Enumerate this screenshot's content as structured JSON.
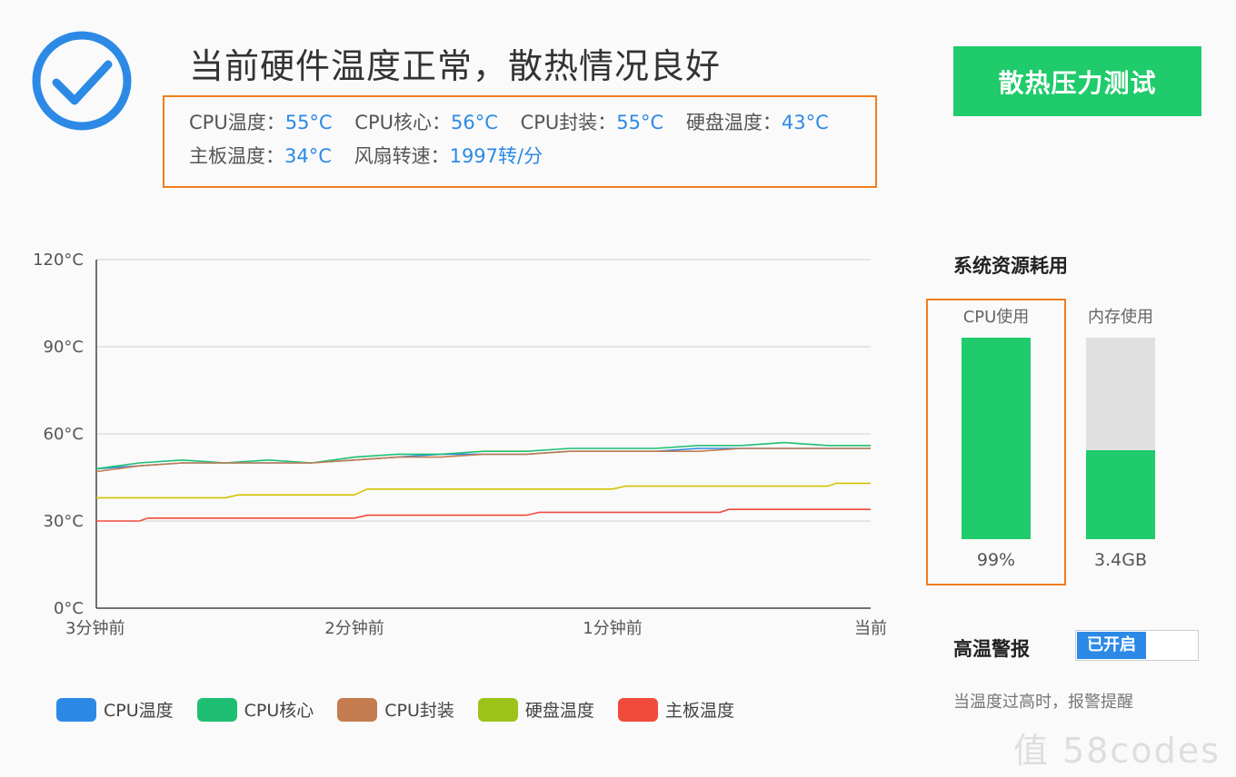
{
  "header": {
    "title": "当前硬件温度正常，散热情况良好",
    "stress_button": "散热压力测试"
  },
  "temps": {
    "row1": [
      {
        "label": "CPU温度：",
        "value": "55°C"
      },
      {
        "label": "CPU核心：",
        "value": "56°C"
      },
      {
        "label": "CPU封装：",
        "value": "55°C"
      },
      {
        "label": "硬盘温度：",
        "value": "43°C"
      }
    ],
    "row2": [
      {
        "label": "主板温度：",
        "value": "34°C"
      },
      {
        "label": "风扇转速：",
        "value": "1997转/分"
      }
    ]
  },
  "chart_data": {
    "type": "line",
    "ylim": [
      0,
      120
    ],
    "yticks": [
      "0°C",
      "30°C",
      "60°C",
      "90°C",
      "120°C"
    ],
    "ytick_values": [
      0,
      30,
      60,
      90,
      120
    ],
    "xlim": [
      -180,
      0
    ],
    "xticks": [
      "3分钟前",
      "2分钟前",
      "1分钟前",
      "当前"
    ],
    "xtick_values": [
      -180,
      -120,
      -60,
      0
    ],
    "grid": true,
    "legend_position": "bottom",
    "series": [
      {
        "name": "CPU温度",
        "color": "#2c8ae6",
        "x": [
          -180,
          -170,
          -160,
          -150,
          -140,
          -130,
          -120,
          -110,
          -100,
          -90,
          -80,
          -70,
          -60,
          -50,
          -40,
          -30,
          -20,
          -10,
          0
        ],
        "y": [
          48,
          49,
          50,
          50,
          50,
          50,
          51,
          52,
          53,
          53,
          53,
          54,
          54,
          54,
          55,
          55,
          55,
          55,
          55
        ]
      },
      {
        "name": "CPU核心",
        "color": "#1fbf73",
        "x": [
          -180,
          -170,
          -160,
          -150,
          -140,
          -130,
          -120,
          -110,
          -100,
          -90,
          -80,
          -70,
          -60,
          -50,
          -40,
          -30,
          -20,
          -10,
          0
        ],
        "y": [
          48,
          50,
          51,
          50,
          51,
          50,
          52,
          53,
          53,
          54,
          54,
          55,
          55,
          55,
          56,
          56,
          57,
          56,
          56
        ]
      },
      {
        "name": "CPU封装",
        "color": "#c47c50",
        "x": [
          -180,
          -170,
          -160,
          -150,
          -140,
          -130,
          -120,
          -110,
          -100,
          -90,
          -80,
          -70,
          -60,
          -50,
          -40,
          -30,
          -20,
          -10,
          0
        ],
        "y": [
          47,
          49,
          50,
          50,
          50,
          50,
          51,
          52,
          52,
          53,
          53,
          54,
          54,
          54,
          54,
          55,
          55,
          55,
          55
        ]
      },
      {
        "name": "硬盘温度",
        "color": "#d4c200",
        "x": [
          -180,
          -150,
          -147,
          -120,
          -117,
          -60,
          -57,
          -10,
          -8,
          0
        ],
        "y": [
          38,
          38,
          39,
          39,
          41,
          41,
          42,
          42,
          43,
          43
        ]
      },
      {
        "name": "主板温度",
        "color": "#f04a3c",
        "x": [
          -180,
          -170,
          -168,
          -120,
          -117,
          -80,
          -77,
          -35,
          -33,
          0
        ],
        "y": [
          30,
          30,
          31,
          31,
          32,
          32,
          33,
          33,
          34,
          34
        ]
      }
    ]
  },
  "legend": [
    {
      "name": "CPU温度",
      "color": "#2c8ae6"
    },
    {
      "name": "CPU核心",
      "color": "#1fbf73"
    },
    {
      "name": "CPU封装",
      "color": "#c47c50"
    },
    {
      "name": "硬盘温度",
      "color": "#9cc31a"
    },
    {
      "name": "主板温度",
      "color": "#f04a3c"
    }
  ],
  "resources": {
    "title": "系统资源耗用",
    "cpu": {
      "label": "CPU使用",
      "value": "99%",
      "level": 1.0
    },
    "mem": {
      "label": "内存使用",
      "value": "3.4GB",
      "level": 0.44
    }
  },
  "alarm": {
    "label": "高温警报",
    "state": "已开启",
    "description": "当温度过高时，报警提醒"
  },
  "watermark": "值 58codes"
}
